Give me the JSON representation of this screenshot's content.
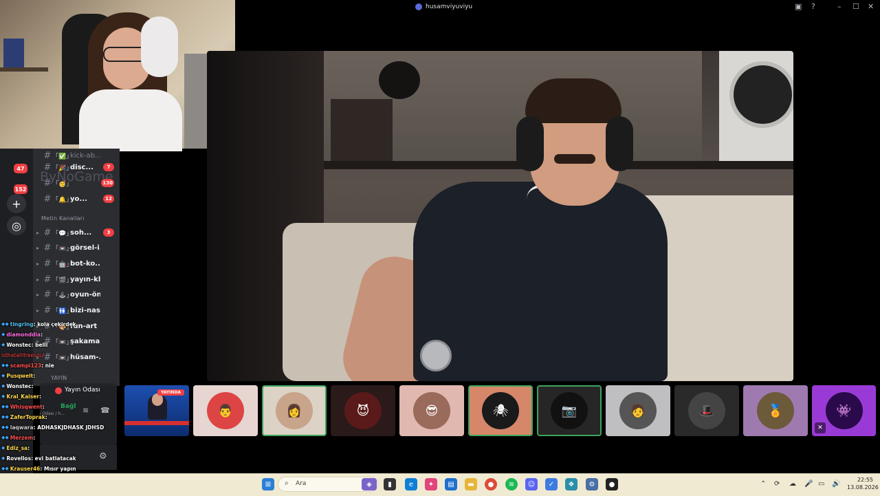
{
  "window": {
    "title": "husamviyuviyu"
  },
  "server_rail": {
    "badges": [
      "47",
      "152"
    ]
  },
  "channel_panel": {
    "faint_title": "ByNoGame",
    "channels": [
      {
        "emoji": "「✅」",
        "name": "kick-ab...",
        "count": "",
        "muted": true
      },
      {
        "emoji": "「🎉」",
        "name": "disc...",
        "count": "7",
        "muted": false
      },
      {
        "emoji": "「🥳」",
        "name": "",
        "count": "130",
        "muted": false
      },
      {
        "emoji": "「🔔」",
        "name": "yo...",
        "count": "12",
        "muted": false
      }
    ],
    "category": "Metin Kanalları",
    "text_channels": [
      {
        "emoji": "「💬」",
        "name": "soh...",
        "count": "3"
      },
      {
        "emoji": "「📼」",
        "name": "görsel-i...",
        "count": ""
      },
      {
        "emoji": "「🤖」",
        "name": "bot-ko...",
        "count": ""
      },
      {
        "emoji": "「🎬」",
        "name": "yayın-kl...",
        "count": ""
      },
      {
        "emoji": "「🕹」",
        "name": "oyun-ön...",
        "count": ""
      },
      {
        "emoji": "「🚻」",
        "name": "bizi-nas...",
        "count": ""
      },
      {
        "emoji": "「🎨」",
        "name": "fun-art",
        "count": ""
      },
      {
        "emoji": "「📼」",
        "name": "şakama...",
        "count": ""
      },
      {
        "emoji": "「📼」",
        "name": "hüsam-...",
        "count": ""
      }
    ],
    "voice_category": "YAYIN"
  },
  "voice_panel": {
    "channel": "Yayın Odası",
    "status": "Bağl",
    "sub": "ı Odası / h..."
  },
  "chat": [
    {
      "user": "tingring",
      "color": "#54c5f8",
      "msg": ": kola çekirdek"
    },
    {
      "user": "diamonddia",
      "color": "#ff6de3",
      "msg": ":"
    },
    {
      "user": "Wonstec",
      "color": "#ffffff",
      "msg": ": belli"
    },
    {
      "user": "isthatallitreesoul",
      "color": "#ff4545",
      "msg": ""
    },
    {
      "user": "scampi123",
      "color": "#ff4d4d",
      "msg": ": nie"
    },
    {
      "user": "Pusqwelt",
      "color": "#ffd84d",
      "msg": ":"
    },
    {
      "user": "Wonstec",
      "color": "#ffffff",
      "msg": ":"
    },
    {
      "user": "Kral_Kaiser",
      "color": "#ffd84d",
      "msg": ":"
    },
    {
      "user": "Whisqwent",
      "color": "#ff4d4d",
      "msg": ":"
    },
    {
      "user": "ZaferToprak",
      "color": "#ffd84d",
      "msg": ":"
    },
    {
      "user": "laqwara",
      "color": "#cfcfcf",
      "msg": ": ADHASKJDHASK JDHSD"
    },
    {
      "user": "Merzem",
      "color": "#ff4d4d",
      "msg": ":"
    },
    {
      "user": "Ediz_sa",
      "color": "#ffd84d",
      "msg": ":"
    },
    {
      "user": "Rovellos",
      "color": "#ffffff",
      "msg": ": evi batlatacak"
    },
    {
      "user": "Krauser46",
      "color": "#ffd84d",
      "msg": ": Mısır yapın"
    }
  ],
  "tiles": [
    {
      "label": "YAYINDA",
      "kind": "tv"
    },
    {
      "avatar": "👨",
      "bg": "#e6d5d0",
      "avbg": "#d44"
    },
    {
      "avatar": "👩",
      "bg": "#dcd2c6",
      "avbg": "#c8a48a",
      "selected": true
    },
    {
      "avatar": "😈",
      "bg": "#2a1a1a",
      "avbg": "#5a1a1a"
    },
    {
      "avatar": "😎",
      "bg": "#e0b8b0",
      "avbg": "#9a6a5a"
    },
    {
      "avatar": "🕷",
      "bg": "#d6876a",
      "avbg": "#1a1a1a",
      "selected": true
    },
    {
      "avatar": "📷",
      "bg": "#262626",
      "avbg": "#111",
      "selected": true
    },
    {
      "avatar": "🧑",
      "bg": "#bfbfc2",
      "avbg": "#555"
    },
    {
      "avatar": "🎩",
      "bg": "#2a2a2a",
      "avbg": "#444"
    },
    {
      "avatar": "🏅",
      "bg": "#9e7ab0",
      "avbg": "#6c5a3a"
    },
    {
      "avatar": "👾",
      "bg": "#9a3ad6",
      "avbg": "#2a0a4a"
    }
  ],
  "taskbar": {
    "search_placeholder": "Ara",
    "time": "22:55",
    "date": "13.08.2026"
  },
  "colors": {
    "accent": "#5865f2",
    "live": "#f23f43",
    "online": "#23a55a"
  }
}
